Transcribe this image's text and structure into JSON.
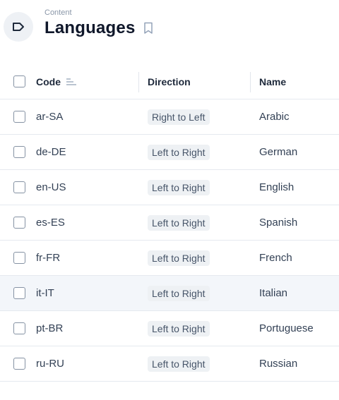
{
  "header": {
    "subtitle": "Content",
    "title": "Languages",
    "collection_icon": "tag-icon",
    "bookmark_icon": "bookmark-icon"
  },
  "table": {
    "columns": {
      "code": "Code",
      "direction": "Direction",
      "name": "Name"
    },
    "sort_icon": "sort-ascending-icon",
    "rows": [
      {
        "code": "ar-SA",
        "direction": "Right to Left",
        "name": "Arabic"
      },
      {
        "code": "de-DE",
        "direction": "Left to Right",
        "name": "German"
      },
      {
        "code": "en-US",
        "direction": "Left to Right",
        "name": "English"
      },
      {
        "code": "es-ES",
        "direction": "Left to Right",
        "name": "Spanish"
      },
      {
        "code": "fr-FR",
        "direction": "Left to Right",
        "name": "French"
      },
      {
        "code": "it-IT",
        "direction": "Left to Right",
        "name": "Italian"
      },
      {
        "code": "pt-BR",
        "direction": "Left to Right",
        "name": "Portuguese"
      },
      {
        "code": "ru-RU",
        "direction": "Left to Right",
        "name": "Russian"
      }
    ]
  },
  "colors": {
    "accent": "#0f172a",
    "row_hover": "#f3f6fa",
    "pill_bg": "#eef1f4",
    "border": "#e5e9ef"
  }
}
